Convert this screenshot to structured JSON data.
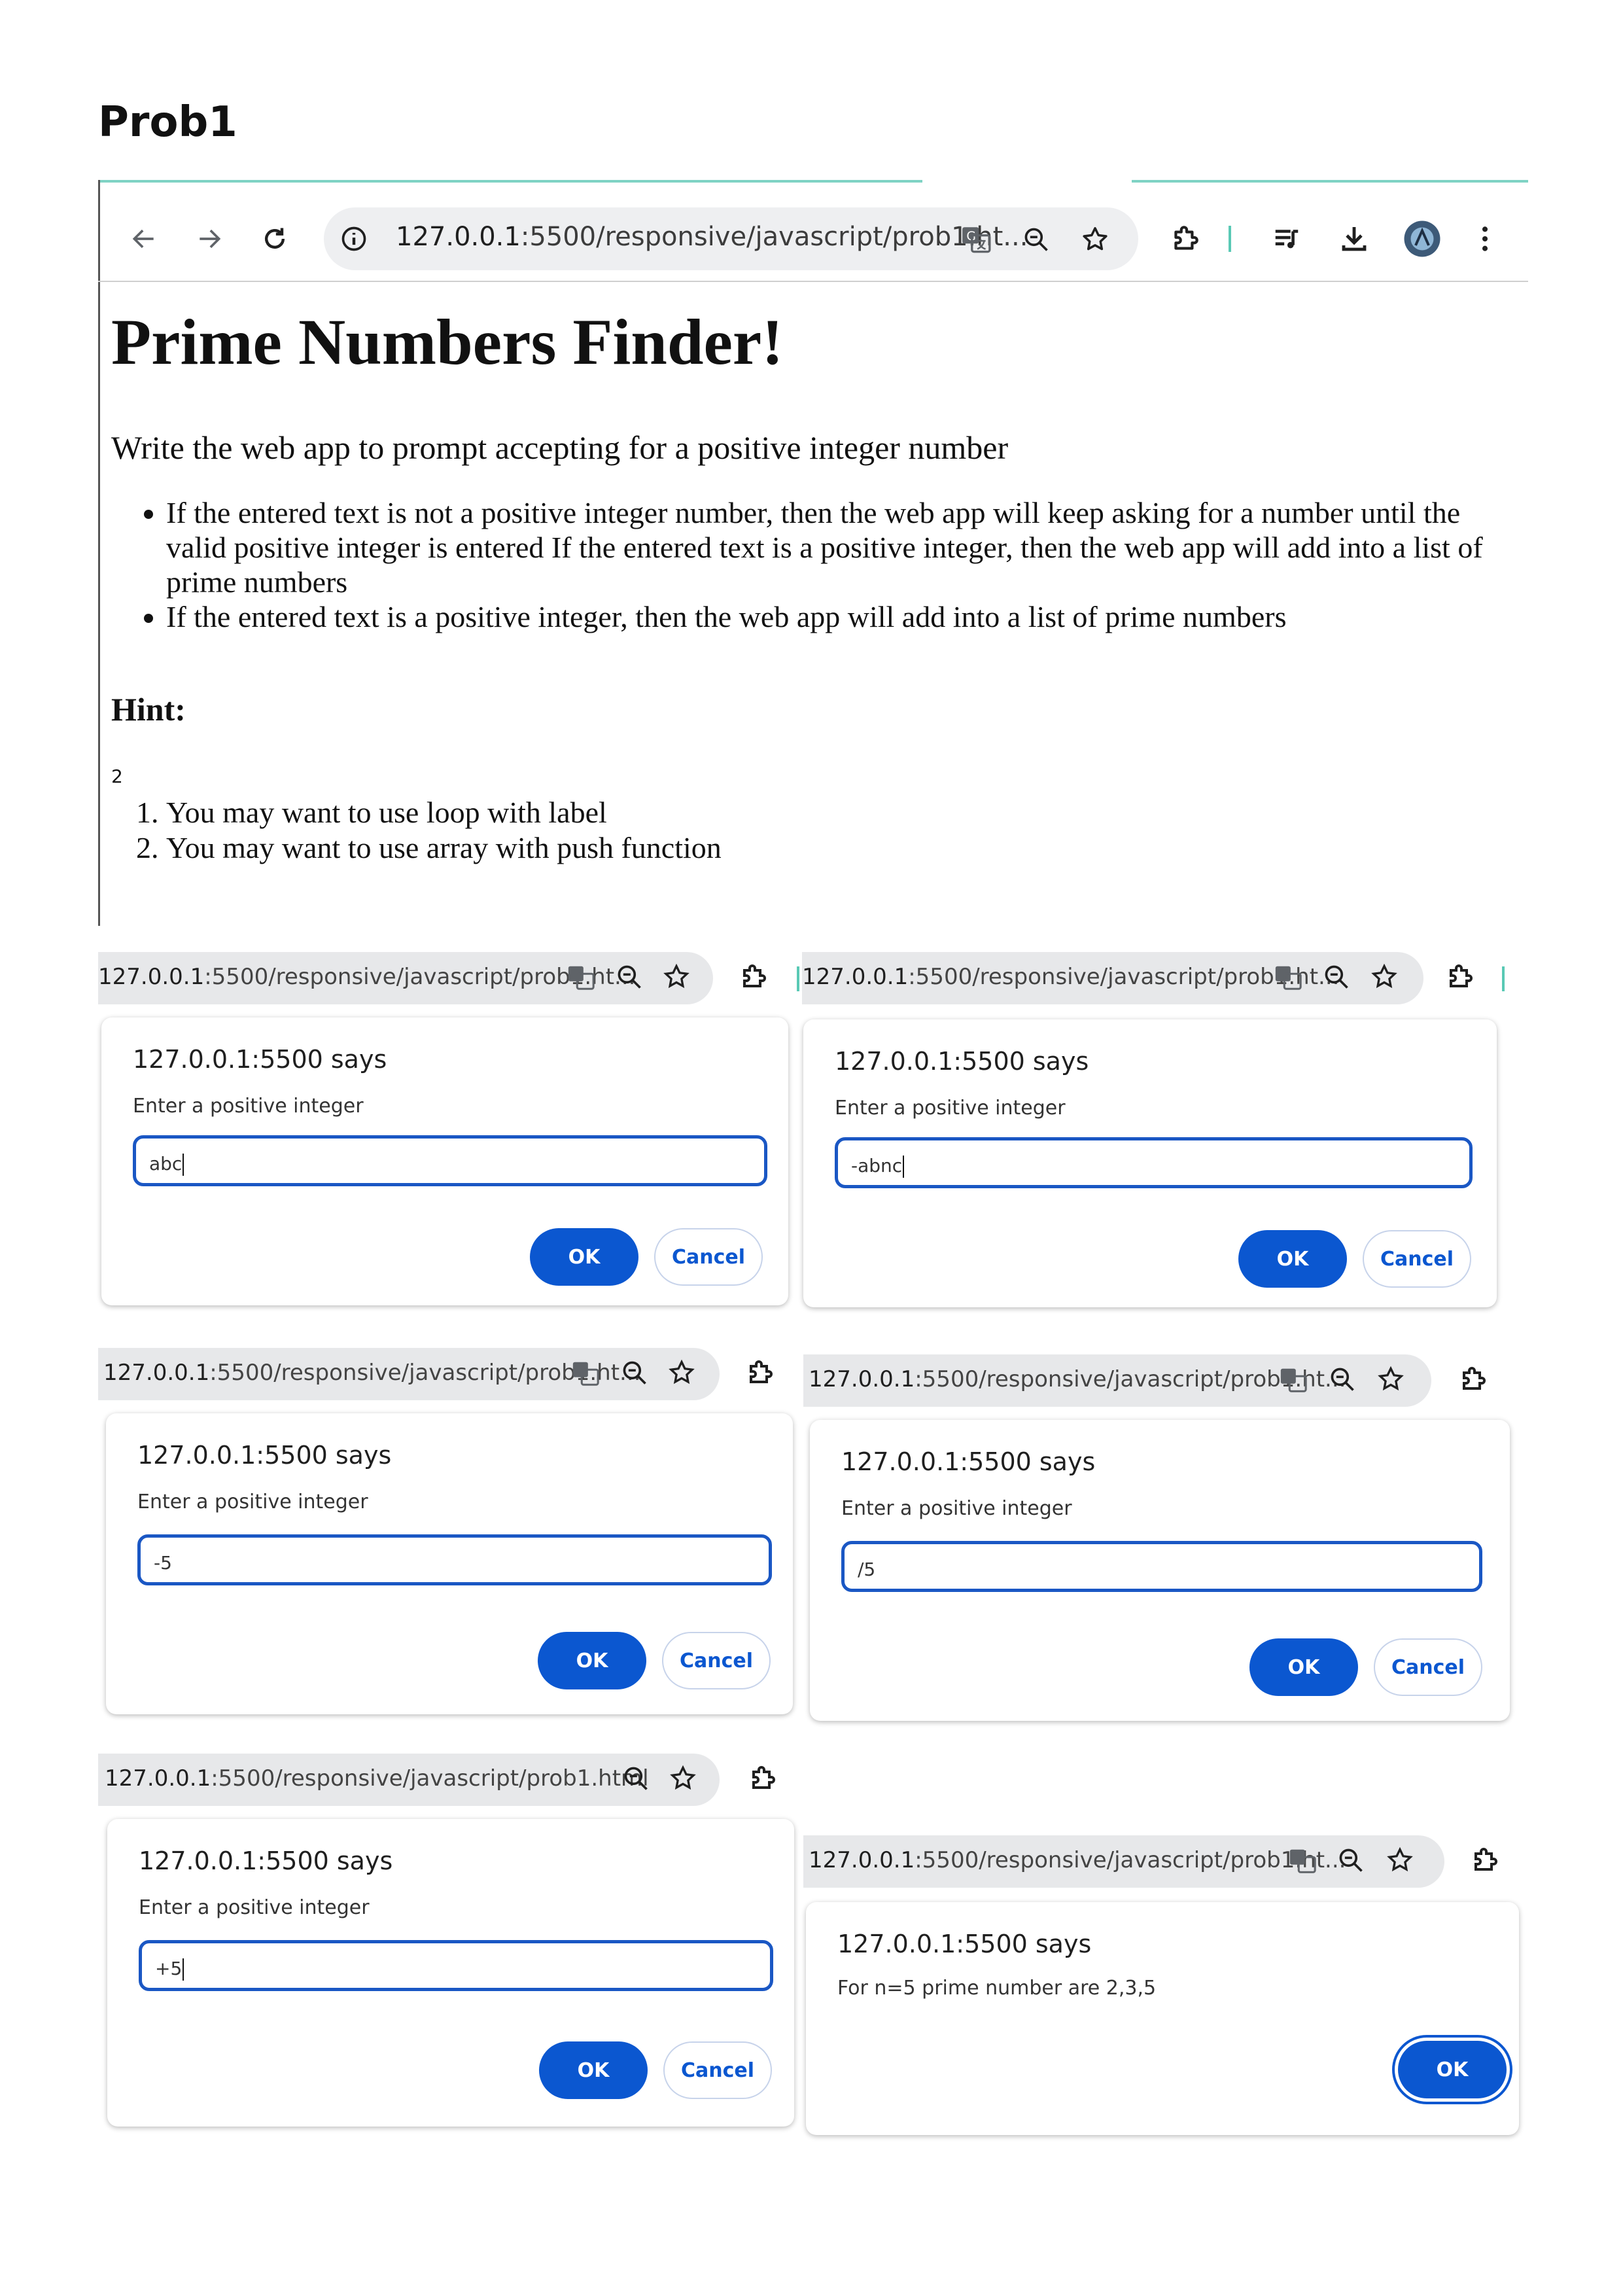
{
  "doc_title": "Prob1",
  "browser": {
    "url_host": "127.0.0.1",
    "url_rest": ":5500/responsive/javascript/prob1.ht...",
    "icons": {
      "back": "arrow-left-icon",
      "forward": "arrow-right-icon",
      "reload": "reload-icon",
      "info": "info-icon",
      "translate": "translate-icon",
      "zoom": "zoom-out-icon",
      "bookmark": "star-icon",
      "extensions": "puzzle-icon",
      "media": "media-queue-icon",
      "download": "download-icon",
      "profile": "avatar",
      "menu": "kebab-menu-icon"
    }
  },
  "page": {
    "heading": "Prime Numbers Finder!",
    "lead": "Write the web app to prompt accepting for a positive integer number",
    "bullets": [
      "If the entered text is not a positive integer number, then the web app will keep asking for a number until the valid positive integer is entered If the entered text is a positive integer, then the web app will add into a list of prime numbers",
      "If the entered text is a positive integer, then the web app will add into a list of prime numbers"
    ],
    "hint_heading": "Hint:",
    "stray_text": "2",
    "hints": [
      "You may want to use loop with label",
      "You may want to use array with push function"
    ]
  },
  "panels": [
    {
      "url_host": "127.0.0.1",
      "url_rest": ":5500/responsive/javascript/prob1.ht...",
      "title": "127.0.0.1:5500 says",
      "message": "Enter a positive integer",
      "input": "abc",
      "ok": "OK",
      "cancel": "Cancel"
    },
    {
      "url_host": "127.0.0.1",
      "url_rest": ":5500/responsive/javascript/prob1.ht...",
      "title": "127.0.0.1:5500 says",
      "message": "Enter a positive integer",
      "input": "-abnc",
      "ok": "OK",
      "cancel": "Cancel"
    },
    {
      "url_host": "127.0.0.1",
      "url_rest": ":5500/responsive/javascript/prob1.ht...",
      "title": "127.0.0.1:5500 says",
      "message": "Enter a positive integer",
      "input": "-5",
      "ok": "OK",
      "cancel": "Cancel"
    },
    {
      "url_host": "127.0.0.1",
      "url_rest": ":5500/responsive/javascript/prob1.ht...",
      "title": "127.0.0.1:5500 says",
      "message": "Enter a positive integer",
      "input": "/5",
      "ok": "OK",
      "cancel": "Cancel"
    },
    {
      "url_host": "127.0.0.1",
      "url_rest": ":5500/responsive/javascript/prob1.html",
      "title": "127.0.0.1:5500 says",
      "message": "Enter a positive integer",
      "input": "+5",
      "ok": "OK",
      "cancel": "Cancel"
    },
    {
      "url_host": "127.0.0.1",
      "url_rest": ":5500/responsive/javascript/prob1.ht...",
      "title": "127.0.0.1:5500 says",
      "message": "For n=5 prime number are 2,3,5",
      "ok": "OK"
    }
  ],
  "colors": {
    "accent": "#0b57d0",
    "teal": "#59c9b5"
  }
}
